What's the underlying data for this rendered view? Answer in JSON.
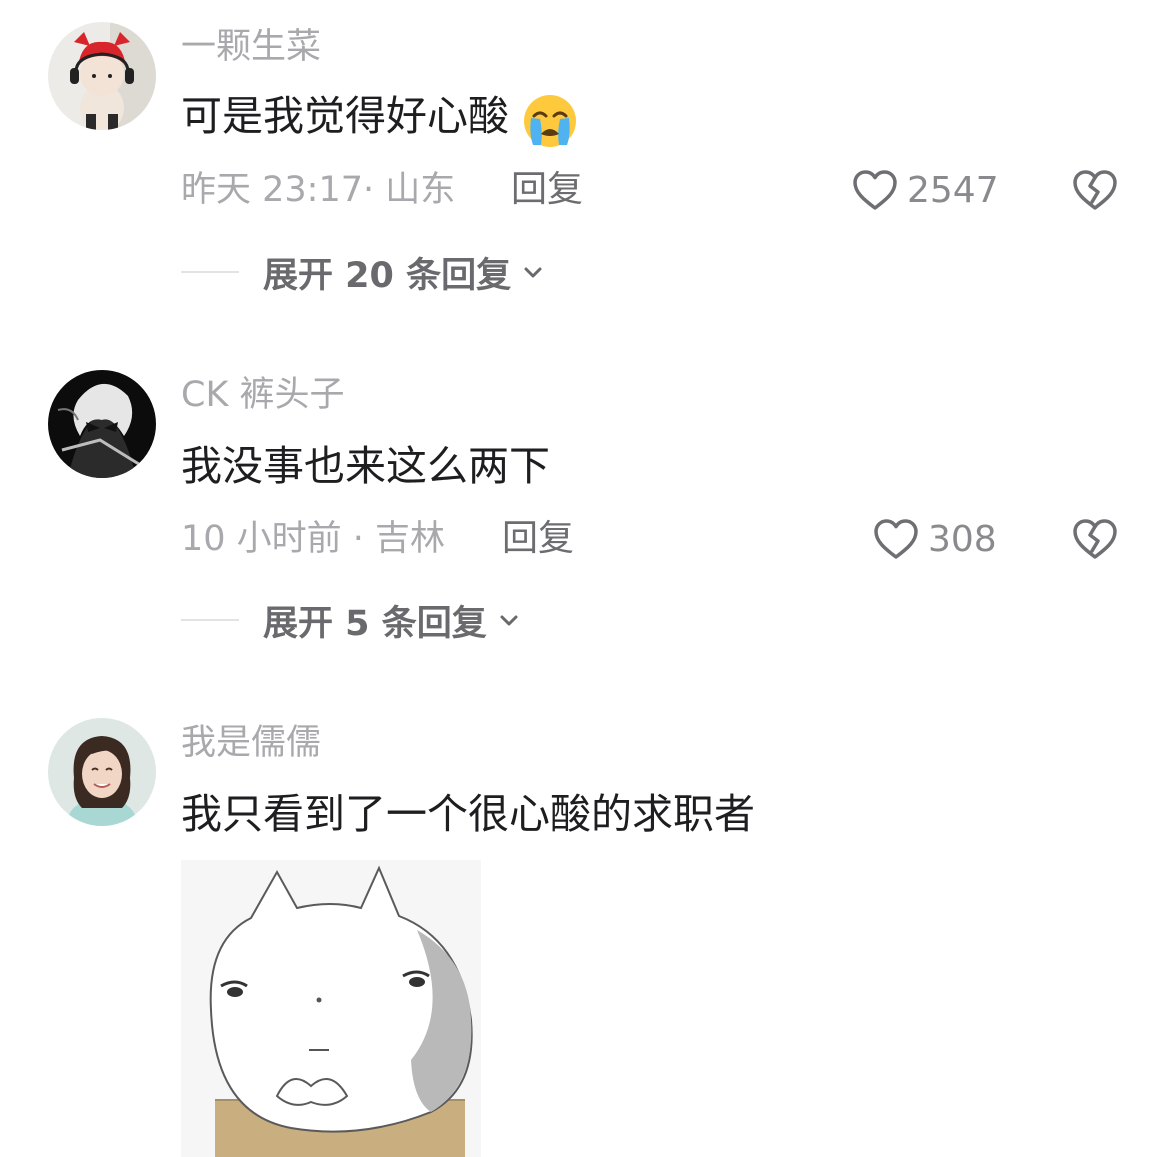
{
  "comments": [
    {
      "username": "一颗生菜",
      "text": "可是我觉得好心酸",
      "emoji": "loudly-crying-face",
      "time_location": "昨天 23:17· 山东",
      "reply_label": "回复",
      "likes": "2547",
      "expand_label": "展开 20 条回复",
      "avatar": "red-hair-doll-with-headphones"
    },
    {
      "username": "CK 裤头子",
      "text": "我没事也来这么两下",
      "time_location": "10 小时前 · 吉林",
      "reply_label": "回复",
      "likes": "308",
      "expand_label": "展开 5 条回复",
      "avatar": "anime-character-monochrome"
    },
    {
      "username": "我是儒儒",
      "text": "我只看到了一个很心酸的求职者",
      "avatar": "smiling-woman-portrait",
      "sticker": "cat-meme-sticker"
    }
  ],
  "colors": {
    "username": "#a9a9ad",
    "content": "#1e1e20",
    "meta": "#a9a9ad",
    "reply": "#6d6d71",
    "icon_stroke": "#6f6f73",
    "divider": "#e3e3e6"
  }
}
